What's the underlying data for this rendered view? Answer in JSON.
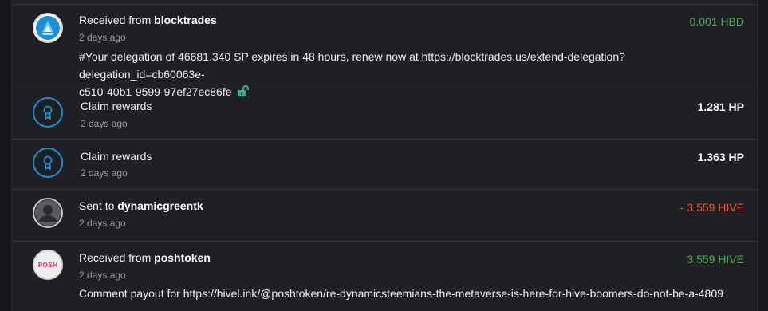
{
  "colors": {
    "positive": "#4caf50",
    "negative": "#e55a3c",
    "neutral": "#ffffff",
    "accent": "#1a8fd8"
  },
  "transactions": [
    {
      "action": "Received from",
      "counterparty": "blocktrades",
      "time": "2 days ago",
      "amount": "0.001 HBD",
      "memo_line1": "#Your delegation of 46681.340 SP expires in 48 hours, renew now at https://blocktrades.us/extend-delegation?delegation_id=cb60063e-",
      "memo_line2": "c510-40b1-9599-97ef27ec86fe",
      "icon": "blocktrades-logo"
    },
    {
      "action": "Claim rewards",
      "time": "2 days ago",
      "amount": "1.281 HP",
      "icon": "award-icon"
    },
    {
      "action": "Claim rewards",
      "time": "2 days ago",
      "amount": "1.363 HP",
      "icon": "award-icon"
    },
    {
      "action": "Sent to",
      "counterparty": "dynamicgreentk",
      "time": "2 days ago",
      "amount": "- 3.559 HIVE",
      "icon": "user-avatar"
    },
    {
      "action": "Received from",
      "counterparty": "poshtoken",
      "time": "2 days ago",
      "amount": "3.559 HIVE",
      "memo_line1": "Comment payout for https://hivel.ink/@poshtoken/re-dynamicsteemians-the-metaverse-is-here-for-hive-boomers-do-not-be-a-4809",
      "icon": "posh-logo",
      "logo_text": "POSH"
    }
  ]
}
